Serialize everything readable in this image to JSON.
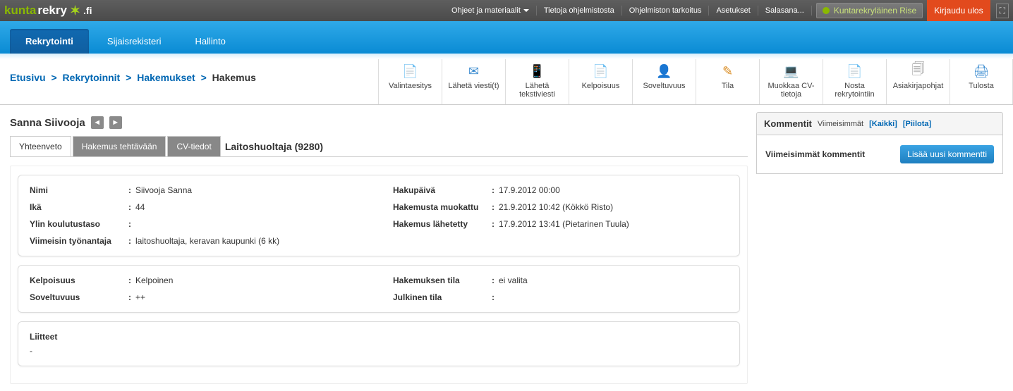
{
  "logo": {
    "k": "kunta",
    "r": "rekry",
    "fi": ".fi"
  },
  "topnav": {
    "item0": "Ohjeet ja materiaalit",
    "item1": "Tietoja ohjelmistosta",
    "item2": "Ohjelmiston tarkoitus",
    "item3": "Asetukset",
    "item4": "Salasana..."
  },
  "user": "Kuntarekryläinen Rise",
  "logout": "Kirjaudu ulos",
  "bluenav": {
    "item0": "Rekrytointi",
    "item1": "Sijaisrekisteri",
    "item2": "Hallinto"
  },
  "breadcrumb": {
    "item0": "Etusivu",
    "item1": "Rekrytoinnit",
    "item2": "Hakemukset",
    "item3": "Hakemus",
    "sep": ">"
  },
  "toolbar": {
    "b0": "Valintaesitys",
    "b1": "Lähetä viesti(t)",
    "b2": "Lähetä tekstiviesti",
    "b3": "Kelpoisuus",
    "b4": "Soveltuvuus",
    "b5": "Tila",
    "b6": "Muokkaa CV-tietoja",
    "b7": "Nosta rekrytointiin",
    "b8": "Asiakirjapohjat",
    "b9": "Tulosta"
  },
  "person": "Sanna Siivooja",
  "tabs": {
    "t0": "Yhteenveto",
    "t1": "Hakemus tehtävään",
    "t2": "CV-tiedot"
  },
  "job_title": "Laitoshuoltaja (9280)",
  "left_block": {
    "l0": "Nimi",
    "v0": "Siivooja Sanna",
    "l1": "Ikä",
    "v1": "44",
    "l2": "Ylin koulutustaso",
    "v2": "",
    "l3": "Viimeisin työnantaja",
    "v3": "laitoshuoltaja, keravan kaupunki (6 kk)"
  },
  "right_block": {
    "l0": "Hakupäivä",
    "v0": "17.9.2012 00:00",
    "l1": "Hakemusta muokattu",
    "v1": "21.9.2012 10:42 (Kökkö Risto)",
    "l2": "Hakemus lähetetty",
    "v2": "17.9.2012 13:41 (Pietarinen Tuula)"
  },
  "status_block": {
    "ll0": "Kelpoisuus",
    "lv0": "Kelpoinen",
    "ll1": "Soveltuvuus",
    "lv1": "++",
    "rl0": "Hakemuksen tila",
    "rv0": "ei valita",
    "rl1": "Julkinen tila",
    "rv1": ""
  },
  "liitteet": {
    "title": "Liitteet",
    "body": "-"
  },
  "side": {
    "heading": "Kommentit",
    "sub": "Viimeisimmät",
    "all": "[Kaikki]",
    "hide": "[Piilota]",
    "latest": "Viimeisimmät kommentit",
    "add": "Lisää uusi kommentti"
  }
}
